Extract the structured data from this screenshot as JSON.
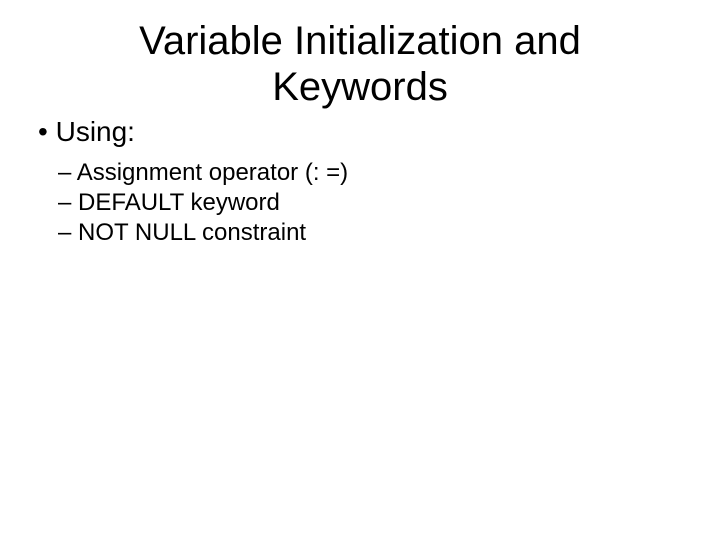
{
  "slide": {
    "title": "Variable Initialization and Keywords",
    "bullet1": "Using:",
    "sub1": "Assignment operator (: =)",
    "sub2": "DEFAULT keyword",
    "sub3": "NOT NULL constraint"
  }
}
